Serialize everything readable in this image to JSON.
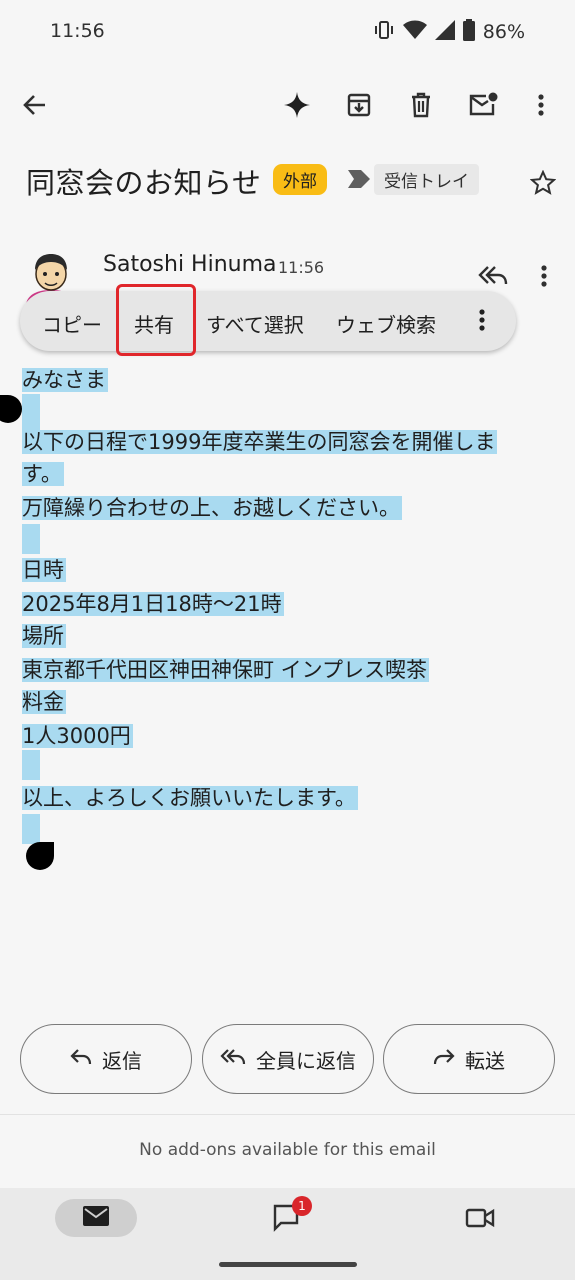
{
  "status_bar": {
    "time": "11:56",
    "battery": "86%",
    "icons": [
      "vibrate-icon",
      "wifi-icon",
      "signal-icon",
      "battery-icon"
    ]
  },
  "toolbar": {
    "icons": [
      "back-arrow-icon",
      "sparkle-icon",
      "archive-icon",
      "delete-icon",
      "mark-unread-icon",
      "more-vert-icon"
    ]
  },
  "email": {
    "subject": "同窓会のお知らせ",
    "external_badge": "外部",
    "label": "受信トレイ",
    "sender_name": "Satoshi Hinuma",
    "time": "11:56"
  },
  "context_menu": {
    "copy": "コピー",
    "share": "共有",
    "select_all": "すべて選択",
    "web_search": "ウェブ検索"
  },
  "body_lines": [
    "みなさま",
    "",
    "以下の日程で1999年度卒業生の同窓会を開催しま",
    "す。",
    "万障繰り合わせの上、お越しください。",
    "",
    "日時",
    "2025年8月1日18時～21時",
    "場所",
    "東京都千代田区神田神保町 インプレス喫茶",
    "料金",
    "1人3000円",
    "",
    "以上、よろしくお願いいたします。"
  ],
  "actions": {
    "reply": "返信",
    "reply_all": "全員に返信",
    "forward": "転送"
  },
  "addons_text": "No add-ons available for this email",
  "bottom_nav": {
    "chat_badge": "1"
  },
  "colors": {
    "selection": "#a9daf0",
    "external_badge": "#f9bc15",
    "highlight_border": "#e0262b",
    "badge_red": "#d9262b"
  }
}
